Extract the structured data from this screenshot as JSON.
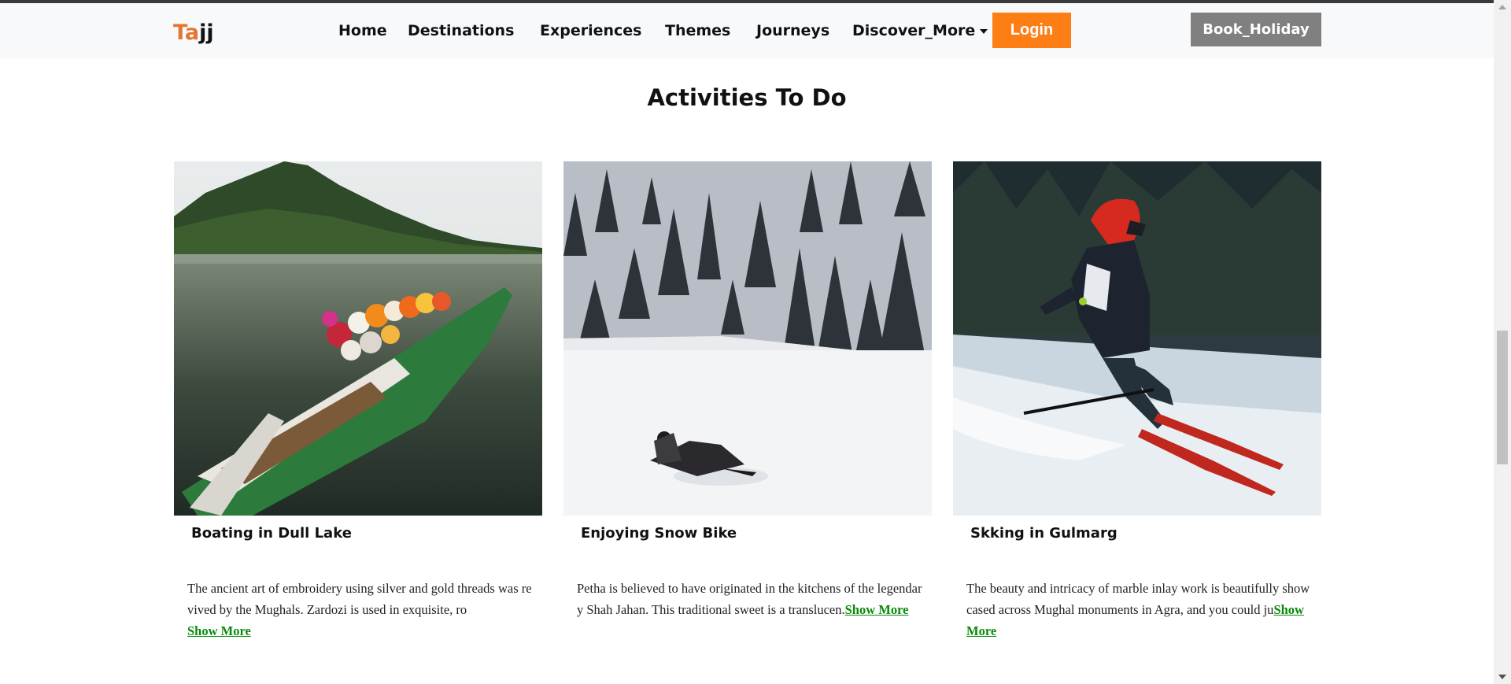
{
  "brand": {
    "part1": "Ta",
    "part2": "jj"
  },
  "nav": {
    "home": "Home",
    "destinations": "Destinations",
    "experiences": "Experiences",
    "themes": "Themes",
    "journeys": "Journeys",
    "discover_more": "Discover_More",
    "login": "Login",
    "book_holiday": "Book_Holiday"
  },
  "section": {
    "title": "Activities To Do"
  },
  "cards": [
    {
      "title": "Boating in Dull Lake",
      "text": "The ancient art of embroidery using silver and gold threads was revived by the Mughals. Zardozi is used in exquisite, ro",
      "more": "Show More"
    },
    {
      "title": "Enjoying Snow Bike",
      "text": "Petha is believed to have originated in the kitchens of the legendary Shah Jahan. This traditional sweet is a translucen.",
      "more": "Show More"
    },
    {
      "title": "Skking in Gulmarg",
      "text": "The beauty and intricacy of marble inlay work is beautifully showcased across Mughal monuments in Agra, and you could ju",
      "more": "Show More"
    }
  ],
  "colors": {
    "accent": "#fd7e14",
    "link": "#0a8a0a",
    "book_button": "#808080"
  }
}
